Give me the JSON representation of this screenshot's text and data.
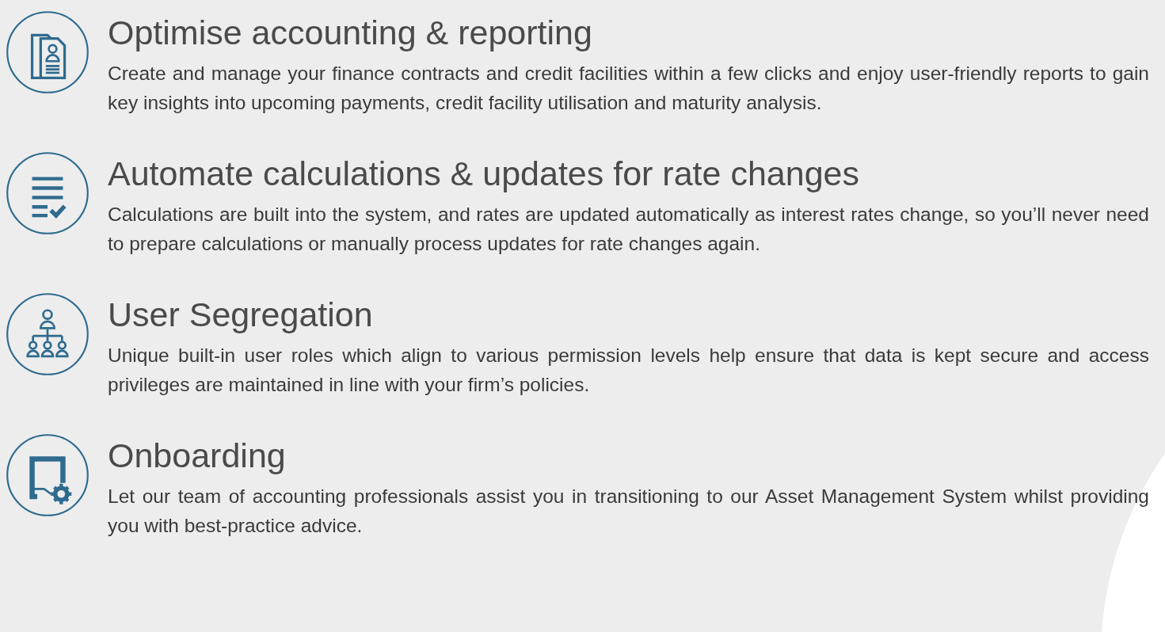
{
  "features": [
    {
      "kind": "documents",
      "title": "Optimise accounting & reporting",
      "text": "Create and manage your finance contracts and credit facilities within a few clicks and enjoy user-friendly reports to gain key insights into upcoming payments, credit facility utilisation and maturity analysis."
    },
    {
      "kind": "checklist",
      "title": "Automate calculations & updates for rate changes",
      "text": "Calculations are built into the system, and rates are updated automatically as interest rates change, so you’ll never need to prepare calculations or manually process updates for rate changes again."
    },
    {
      "kind": "hierarchy",
      "title": "User Segregation",
      "text": "Unique built-in user roles which align to various permission levels help ensure that data is kept secure and access privileges are maintained in line with your firm’s policies."
    },
    {
      "kind": "screen-gear",
      "title": "Onboarding",
      "text": "Let our team of accounting professionals assist you in transitioning to our Asset Management System whilst providing you with best-practice advice."
    }
  ]
}
